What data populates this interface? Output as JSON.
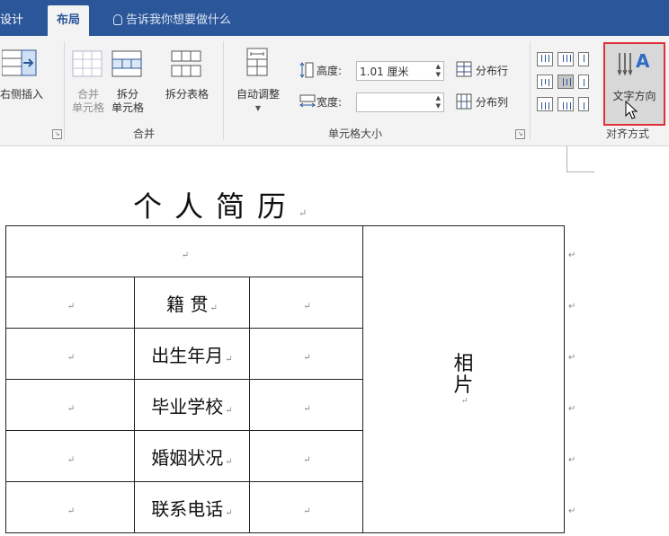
{
  "tabs": {
    "design": "设计",
    "layout": "布局",
    "tell_me": "告诉我你想要做什么"
  },
  "ribbon": {
    "insert_right": "右侧插入",
    "merge_cells": [
      "合并",
      "单元格"
    ],
    "split_cells": [
      "拆分",
      "单元格"
    ],
    "split_table": "拆分表格",
    "merge_group": "合并",
    "autofit": "自动调整",
    "height_label": "高度:",
    "height_value": "1.01 厘米",
    "width_label": "宽度:",
    "width_value": "",
    "distribute_rows": "分布行",
    "distribute_cols": "分布列",
    "cell_size_group": "单元格大小",
    "text_direction": "文字方向",
    "alignment_group": "对齐方式"
  },
  "document": {
    "title": "个人简历",
    "para_mark": "↵",
    "labels": [
      "籍   贯",
      "出生年月",
      "毕业学校",
      "婚姻状况",
      "联系电话"
    ],
    "photo": [
      "相",
      "片"
    ]
  },
  "colors": {
    "tab_bar": "#2b579a",
    "ribbon": "#f3f3f3",
    "highlight": "#e0303b"
  }
}
